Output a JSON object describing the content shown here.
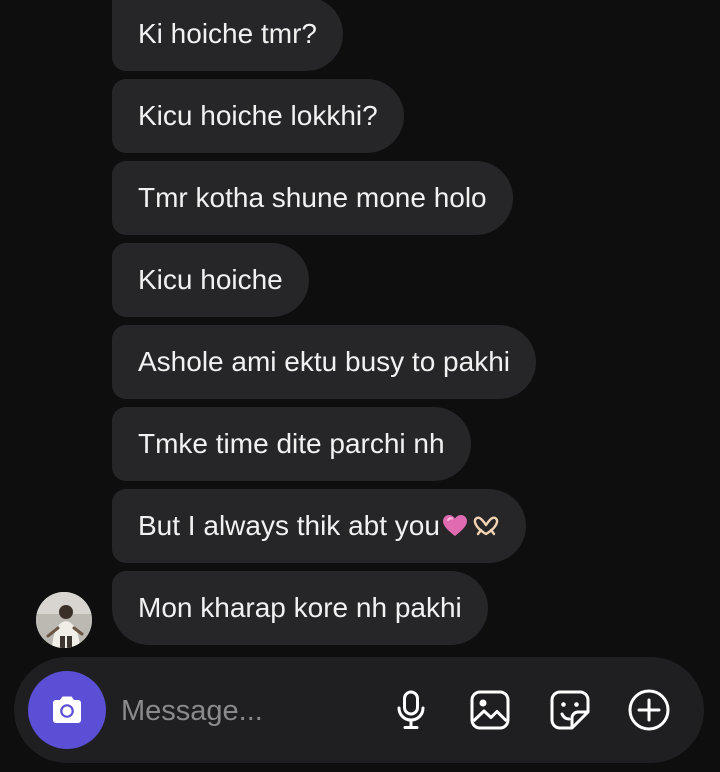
{
  "messages": [
    {
      "text": "Ki hoiche tmr?"
    },
    {
      "text": "Kicu hoiche lokkhi?"
    },
    {
      "text": "Tmr kotha shune mone holo"
    },
    {
      "text": "Kicu hoiche"
    },
    {
      "text": "Ashole ami ektu busy to pakhi"
    },
    {
      "text": "Tmke time dite parchi nh"
    },
    {
      "text": "But I always thik abt you"
    },
    {
      "text": "Mon kharap kore nh pakhi"
    }
  ],
  "composer": {
    "placeholder": "Message..."
  },
  "icons": {
    "camera": "camera-icon",
    "mic": "microphone-icon",
    "gallery": "image-gallery-icon",
    "sticker": "sticker-icon",
    "add": "plus-circle-icon"
  },
  "colors": {
    "background": "#0e0e0f",
    "bubble": "#262628",
    "accent": "#5b4fd6"
  }
}
